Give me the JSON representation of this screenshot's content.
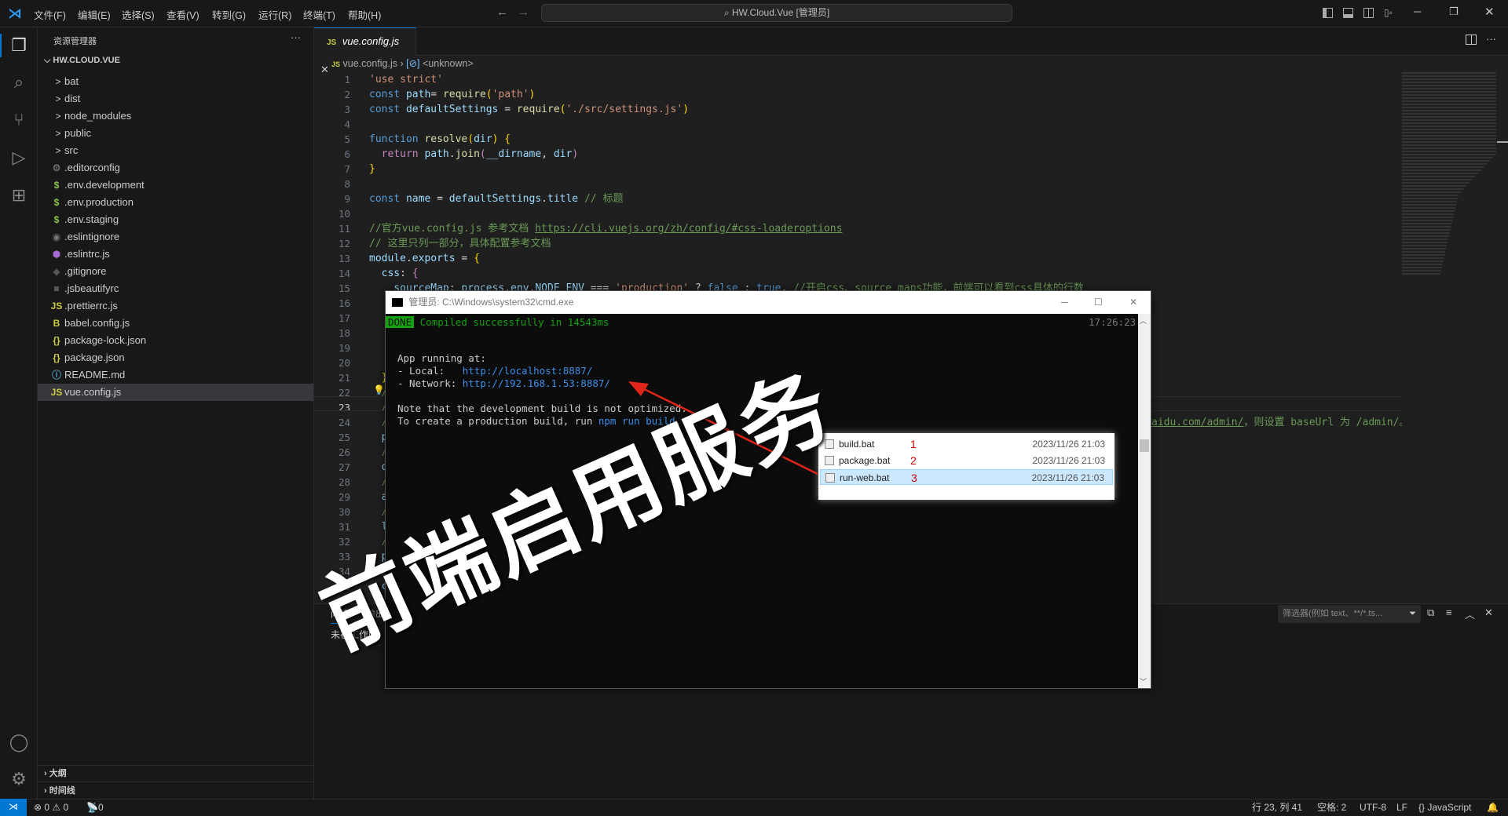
{
  "titlebar": {
    "menus": [
      "文件(F)",
      "编辑(E)",
      "选择(S)",
      "查看(V)",
      "转到(G)",
      "运行(R)",
      "终端(T)",
      "帮助(H)"
    ],
    "search": "HW.Cloud.Vue [管理员]"
  },
  "sidebar": {
    "title": "资源管理器",
    "more": "···",
    "root": "HW.CLOUD.VUE",
    "items": [
      {
        "label": "bat",
        "icon": ">",
        "type": "folder"
      },
      {
        "label": "dist",
        "icon": ">",
        "type": "folder"
      },
      {
        "label": "node_modules",
        "icon": ">",
        "type": "folder"
      },
      {
        "label": "public",
        "icon": ">",
        "type": "folder"
      },
      {
        "label": "src",
        "icon": ">",
        "type": "folder"
      },
      {
        "label": ".editorconfig",
        "icon": "⚙",
        "color": "#8a8a8a"
      },
      {
        "label": ".env.development",
        "icon": "$",
        "color": "#8bc34a"
      },
      {
        "label": ".env.production",
        "icon": "$",
        "color": "#8bc34a"
      },
      {
        "label": ".env.staging",
        "icon": "$",
        "color": "#8bc34a"
      },
      {
        "label": ".eslintignore",
        "icon": "◉",
        "color": "#777"
      },
      {
        "label": ".eslintrc.js",
        "icon": "⬢",
        "color": "#a66bd3"
      },
      {
        "label": ".gitignore",
        "icon": "◆",
        "color": "#555"
      },
      {
        "label": ".jsbeautifyrc",
        "icon": "≡",
        "color": "#aaa"
      },
      {
        "label": ".prettierrc.js",
        "icon": "JS",
        "color": "#cbcb41"
      },
      {
        "label": "babel.config.js",
        "icon": "B",
        "color": "#cbcb41"
      },
      {
        "label": "package-lock.json",
        "icon": "{}",
        "color": "#cbcb41"
      },
      {
        "label": "package.json",
        "icon": "{}",
        "color": "#cbcb41"
      },
      {
        "label": "README.md",
        "icon": "ⓘ",
        "color": "#519aba"
      },
      {
        "label": "vue.config.js",
        "icon": "JS",
        "color": "#cbcb41",
        "selected": true
      }
    ],
    "outline": "大纲",
    "timeline": "时间线"
  },
  "editor": {
    "tab": "vue.config.js",
    "tab_icon": "JS",
    "breadcrumb_file": "vue.config.js",
    "breadcrumb_symbol": "<unknown>",
    "lines": [
      [
        [
          "s",
          "'use strict'"
        ]
      ],
      [
        [
          "k",
          "const "
        ],
        [
          "v",
          "path"
        ],
        [
          "",
          "= "
        ],
        [
          "f",
          "require"
        ],
        [
          "p",
          "("
        ],
        [
          "s",
          "'path'"
        ],
        [
          "p",
          ")"
        ]
      ],
      [
        [
          "k",
          "const "
        ],
        [
          "v",
          "defaultSettings"
        ],
        [
          "",
          " = "
        ],
        [
          "f",
          "require"
        ],
        [
          "p",
          "("
        ],
        [
          "s",
          "'./src/settings.js'"
        ],
        [
          "p",
          ")"
        ]
      ],
      [],
      [
        [
          "k",
          "function "
        ],
        [
          "f",
          "resolve"
        ],
        [
          "p",
          "("
        ],
        [
          "v",
          "dir"
        ],
        [
          "p",
          ")"
        ],
        [
          "",
          " "
        ],
        [
          "p",
          "{"
        ]
      ],
      [
        [
          "",
          "  "
        ],
        [
          "pk",
          "return "
        ],
        [
          "v",
          "path"
        ],
        [
          "",
          "."
        ],
        [
          "f",
          "join"
        ],
        [
          "pk",
          "("
        ],
        [
          "v",
          "__dirname"
        ],
        [
          "",
          ", "
        ],
        [
          "v",
          "dir"
        ],
        [
          "pk",
          ")"
        ]
      ],
      [
        [
          "p",
          "}"
        ]
      ],
      [],
      [
        [
          "k",
          "const "
        ],
        [
          "v",
          "name"
        ],
        [
          "",
          " = "
        ],
        [
          "v",
          "defaultSettings"
        ],
        [
          "",
          "."
        ],
        [
          "v",
          "title"
        ],
        [
          "c",
          " // 标题"
        ]
      ],
      [],
      [
        [
          "c",
          "//官方vue.config.js 参考文档 "
        ],
        [
          "u",
          "https://cli.vuejs.org/zh/config/#css-loaderoptions"
        ]
      ],
      [
        [
          "c",
          "// 这里只列一部分，具体配置参考文档"
        ]
      ],
      [
        [
          "v",
          "module"
        ],
        [
          "",
          "."
        ],
        [
          "v",
          "exports"
        ],
        [
          "",
          " = "
        ],
        [
          "p",
          "{"
        ]
      ],
      [
        [
          "",
          "  "
        ],
        [
          "v",
          "css"
        ],
        [
          "",
          ": "
        ],
        [
          "pk",
          "{"
        ]
      ],
      [
        [
          "",
          "    "
        ],
        [
          "v",
          "sourceMap"
        ],
        [
          "",
          ": "
        ],
        [
          "v",
          "process"
        ],
        [
          "",
          "."
        ],
        [
          "v",
          "env"
        ],
        [
          "",
          "."
        ],
        [
          "v",
          "NODE_ENV"
        ],
        [
          "",
          " === "
        ],
        [
          "s",
          "'production'"
        ],
        [
          "",
          " ? "
        ],
        [
          "k",
          "false"
        ],
        [
          "",
          " : "
        ],
        [
          "k",
          "true"
        ],
        [
          "",
          ", "
        ],
        [
          "c",
          "//开启css、source maps功能，前端可以看到css具体的行数"
        ]
      ],
      [],
      [],
      [],
      [],
      [],
      [
        [
          "",
          "  "
        ],
        [
          "p",
          "}"
        ]
      ],
      [
        [
          "",
          "  "
        ],
        [
          "c",
          "/"
        ]
      ],
      [
        [
          "",
          "  "
        ],
        [
          "c",
          "/"
        ]
      ],
      [
        [
          "",
          "  "
        ],
        [
          "c",
          "/"
        ]
      ],
      [
        [
          "",
          "  "
        ],
        [
          "v",
          "p"
        ]
      ],
      [
        [
          "",
          "  "
        ],
        [
          "c",
          "/"
        ]
      ],
      [
        [
          "",
          "  "
        ],
        [
          "v",
          "o"
        ]
      ],
      [
        [
          "",
          "  "
        ],
        [
          "c",
          "/"
        ]
      ],
      [
        [
          "",
          "  "
        ],
        [
          "v",
          "a"
        ]
      ],
      [
        [
          "",
          "  "
        ],
        [
          "c",
          "/"
        ]
      ],
      [
        [
          "",
          "  "
        ],
        [
          "v",
          "l"
        ]
      ],
      [
        [
          "",
          "  "
        ],
        [
          "c",
          "/"
        ]
      ],
      [
        [
          "",
          "  "
        ],
        [
          "v",
          "p"
        ]
      ],
      [
        [
          "",
          "  "
        ],
        [
          "c",
          "/"
        ]
      ],
      [
        [
          "",
          "  "
        ],
        [
          "v",
          "c"
        ]
      ]
    ],
    "line24_tail": [
      [
        "u",
        "aidu.com/admin/"
      ],
      [
        "c",
        "，则设置 baseUrl 为 /admin/。"
      ]
    ]
  },
  "panel": {
    "tabs": [
      "问题",
      "输出"
    ],
    "message": "未在工作区",
    "filter_placeholder": "筛选器(例如 text、**/*.ts..."
  },
  "cmd": {
    "title": "管理员: C:\\Windows\\system32\\cmd.exe",
    "done": "DONE",
    "compiled": "Compiled successfully in 14543ms",
    "time": "17:26:23",
    "app_running": "App running at:",
    "local_label": "- Local:   ",
    "local_url": "http://localhost:8887/",
    "network_label": "- Network: ",
    "network_url": "http://192.168.1.53:8887/",
    "note": "Note that the development build is not optimized.",
    "create_prefix": "To create a production build, run ",
    "create_cmd": "npm run build",
    "create_suffix": "."
  },
  "popup": {
    "files": [
      {
        "name": "build.bat",
        "num": "1",
        "date": "2023/11/26 21:03"
      },
      {
        "name": "package.bat",
        "num": "2",
        "date": "2023/11/26 21:03"
      },
      {
        "name": "run-web.bat",
        "num": "3",
        "date": "2023/11/26 21:03",
        "selected": true
      }
    ]
  },
  "watermark": "前端启用服务",
  "statusbar": {
    "errors": "0",
    "warnings": "0",
    "ports": "0",
    "position": "行 23, 列 41",
    "spaces": "空格: 2",
    "encoding": "UTF-8",
    "eol": "LF",
    "language": "JavaScript"
  },
  "colors": {
    "accent": "#0078d4",
    "done_bg": "#13a10e",
    "compiled": "#13a10e",
    "arrow": "#e0261a"
  }
}
